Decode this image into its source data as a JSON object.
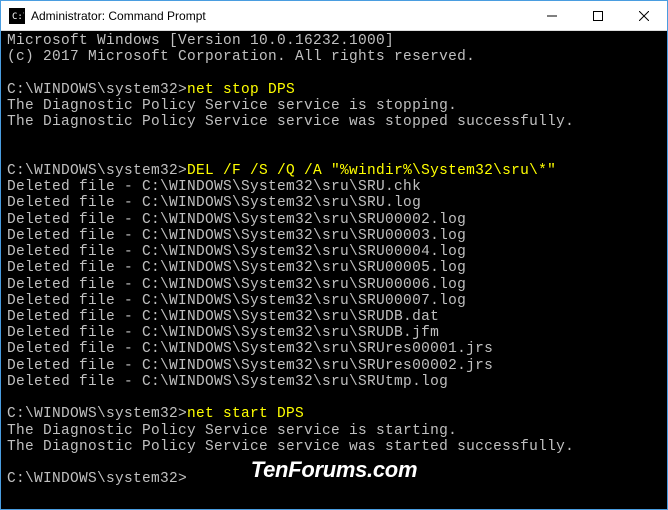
{
  "titlebar": {
    "title": "Administrator: Command Prompt"
  },
  "terminal": {
    "header1": "Microsoft Windows [Version 10.0.16232.1000]",
    "header2": "(c) 2017 Microsoft Corporation. All rights reserved.",
    "prompt": "C:\\WINDOWS\\system32>",
    "cmd1": "net stop DPS",
    "out1a": "The Diagnostic Policy Service service is stopping.",
    "out1b": "The Diagnostic Policy Service service was stopped successfully.",
    "cmd2": "DEL /F /S /Q /A \"%windir%\\System32\\sru\\*\"",
    "deleted": [
      "Deleted file - C:\\WINDOWS\\System32\\sru\\SRU.chk",
      "Deleted file - C:\\WINDOWS\\System32\\sru\\SRU.log",
      "Deleted file - C:\\WINDOWS\\System32\\sru\\SRU00002.log",
      "Deleted file - C:\\WINDOWS\\System32\\sru\\SRU00003.log",
      "Deleted file - C:\\WINDOWS\\System32\\sru\\SRU00004.log",
      "Deleted file - C:\\WINDOWS\\System32\\sru\\SRU00005.log",
      "Deleted file - C:\\WINDOWS\\System32\\sru\\SRU00006.log",
      "Deleted file - C:\\WINDOWS\\System32\\sru\\SRU00007.log",
      "Deleted file - C:\\WINDOWS\\System32\\sru\\SRUDB.dat",
      "Deleted file - C:\\WINDOWS\\System32\\sru\\SRUDB.jfm",
      "Deleted file - C:\\WINDOWS\\System32\\sru\\SRUres00001.jrs",
      "Deleted file - C:\\WINDOWS\\System32\\sru\\SRUres00002.jrs",
      "Deleted file - C:\\WINDOWS\\System32\\sru\\SRUtmp.log"
    ],
    "cmd3": "net start DPS",
    "out3a": "The Diagnostic Policy Service service is starting.",
    "out3b": "The Diagnostic Policy Service service was started successfully."
  },
  "watermark": "TenForums.com"
}
